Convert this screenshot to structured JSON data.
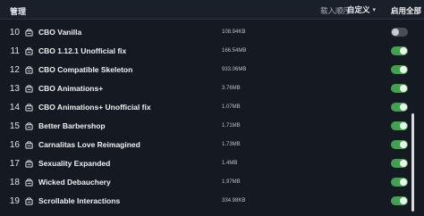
{
  "header": {
    "manage_label": "管理",
    "load_order_label": "载入顺序",
    "sort_label": "自定义",
    "enable_all_label": "启用全部"
  },
  "mods": [
    {
      "index": "10",
      "name": "CBO Vanilla",
      "size": "108.94KB",
      "enabled": false
    },
    {
      "index": "11",
      "name": "CBO 1.12.1 Unofficial fix",
      "size": "166.54MB",
      "enabled": true
    },
    {
      "index": "12",
      "name": "CBO Compatible Skeleton",
      "size": "933.06MB",
      "enabled": true
    },
    {
      "index": "13",
      "name": "CBO Animations+",
      "size": "3.76MB",
      "enabled": true
    },
    {
      "index": "14",
      "name": "CBO Animations+ Unofficial fix",
      "size": "1.07MB",
      "enabled": true
    },
    {
      "index": "15",
      "name": "Better Barbershop",
      "size": "1.71MB",
      "enabled": true
    },
    {
      "index": "16",
      "name": "Carnalitas Love Reimagined",
      "size": "1.73MB",
      "enabled": true
    },
    {
      "index": "17",
      "name": "Sexuality Expanded",
      "size": "1.4MB",
      "enabled": true
    },
    {
      "index": "18",
      "name": "Wicked Debauchery",
      "size": "1.97MB",
      "enabled": true
    },
    {
      "index": "19",
      "name": "Scrollable Interactions",
      "size": "334.98KB",
      "enabled": true
    }
  ],
  "colors": {
    "background": "#151a22",
    "toggle_on": "#3fa34d",
    "toggle_off": "#4a4f57"
  },
  "icons": {
    "row_icon": "package-icon",
    "sort_caret": "chevron-down-icon"
  }
}
